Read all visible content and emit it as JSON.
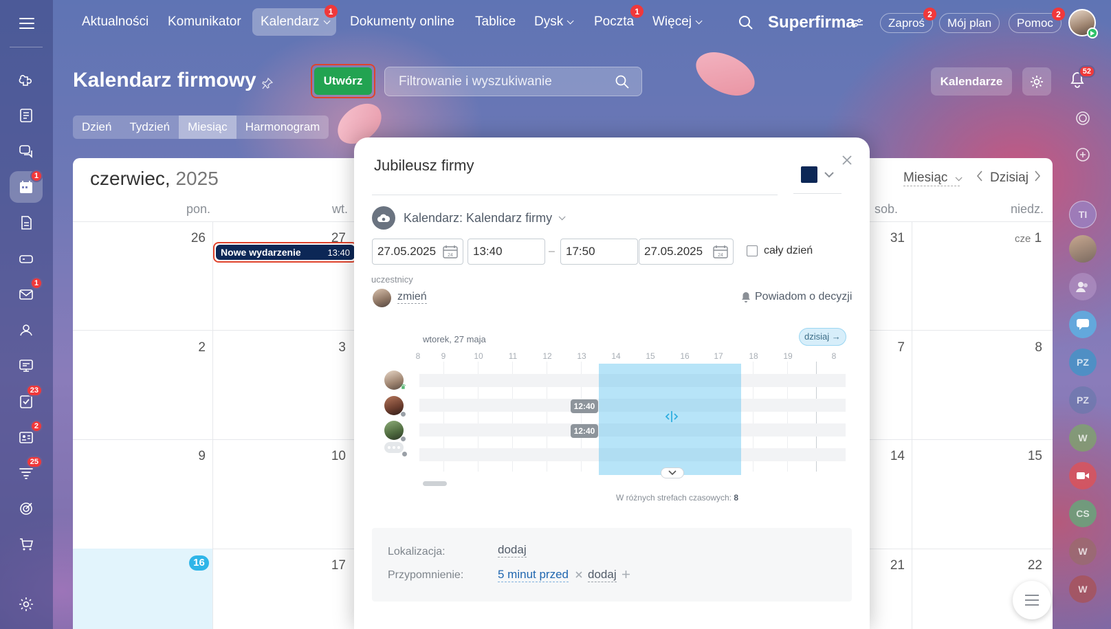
{
  "top_nav": {
    "items": [
      {
        "label": "Aktualności"
      },
      {
        "label": "Komunikator"
      },
      {
        "label": "Kalendarz",
        "badge": "1"
      },
      {
        "label": "Dokumenty online"
      },
      {
        "label": "Tablice"
      },
      {
        "label": "Dysk"
      },
      {
        "label": "Poczta",
        "badge": "1"
      },
      {
        "label": "Więcej"
      }
    ],
    "brand": "Superfirma",
    "invite": {
      "label": "Zaproś",
      "badge": "2"
    },
    "my_plan": "Mój plan",
    "help": {
      "label": "Pomoc",
      "badge": "2"
    }
  },
  "left_rail": {
    "badges": {
      "calendar": "1",
      "mail": "1",
      "tasks": "23",
      "feed": "2",
      "crm": "25"
    }
  },
  "header": {
    "title": "Kalendarz firmowy",
    "create_label": "Utwórz",
    "search_placeholder": "Filtrowanie i wyszukiwanie",
    "calendars_label": "Kalendarze",
    "notifications_badge": "52"
  },
  "view_tabs": [
    "Dzień",
    "Tydzień",
    "Miesiąc",
    "Harmonogram"
  ],
  "calendar": {
    "month": "czerwiec,",
    "year": "2025",
    "weekdays": {
      "mon": "pon.",
      "tue": "wt.",
      "sat": "sob.",
      "sun": "niedz."
    },
    "view_select": "Miesiąc",
    "today_btn": "Dzisiaj",
    "days": {
      "r1c1": "26",
      "r1c2": "27",
      "r1c6": "31",
      "r1c7_prefix": "cze",
      "r1c7": "1",
      "r2c1": "2",
      "r2c2": "3",
      "r2c6": "7",
      "r2c7": "8",
      "r3c1": "9",
      "r3c2": "10",
      "r3c6": "14",
      "r3c7": "15",
      "r4c1": "16",
      "r4c2": "17",
      "r4c6": "21",
      "r4c7": "22"
    },
    "event": {
      "title": "Nowe wydarzenie",
      "time": "13:40"
    }
  },
  "right_rail": {
    "initials": [
      "TI",
      "PZ",
      "PZ",
      "W",
      "CS",
      "W",
      "W"
    ]
  },
  "modal": {
    "title": "Jubileusz firmy",
    "calendar_line": "Kalendarz: Kalendarz firmy",
    "date_from": "27.05.2025",
    "time_from": "13:40",
    "time_to": "17:50",
    "date_to": "27.05.2025",
    "all_day": "cały dzień",
    "participants_label": "uczestnicy",
    "change_link": "zmień",
    "notify_label": "Powiadom o decyzji",
    "planner": {
      "date_label": "wtorek, 27 maja",
      "today_btn": "dzisiaj →",
      "hours": [
        "8",
        "9",
        "10",
        "11",
        "12",
        "13",
        "14",
        "15",
        "16",
        "17",
        "18",
        "19",
        "8"
      ],
      "busy_tags": [
        "12:40",
        "12:40"
      ],
      "tz_note": "W różnych strefach czasowych:",
      "tz_count": "8"
    },
    "location_label": "Lokalizacja:",
    "location_add": "dodaj",
    "reminder_label": "Przypomnienie:",
    "reminder_value": "5 minut przed",
    "reminder_add": "dodaj"
  },
  "colors": {
    "accent_green": "#22a351",
    "event_navy": "#0c2756",
    "highlight_red": "#e0432c",
    "today_blue": "#2fb5e8"
  }
}
